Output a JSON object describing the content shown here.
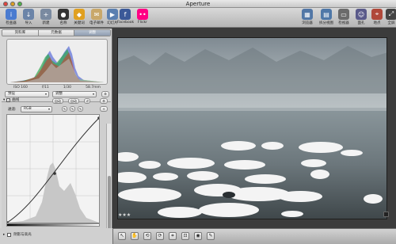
{
  "window": {
    "title": "Aperture"
  },
  "toolbar": {
    "left": [
      {
        "label": "检查器",
        "icon": "info-icon",
        "color": "#4a7bd0"
      },
      {
        "label": "导入",
        "icon": "import-arrow-icon",
        "color": "#6b84a8"
      },
      {
        "label": "新建",
        "icon": "new-folder-icon",
        "color": "#7a8aa0"
      },
      {
        "label": "名称",
        "icon": "person-silhouette-icon",
        "color": "#333333"
      },
      {
        "label": "关键词",
        "icon": "keyword-tag-icon",
        "color": "#e0a020"
      },
      {
        "label": "电子邮件",
        "icon": "envelope-icon",
        "color": "#c9a86a"
      },
      {
        "label": "幻灯片",
        "icon": "slideshow-icon",
        "color": "#5b7fb0"
      },
      {
        "label": "Facebook",
        "icon": "facebook-icon",
        "color": "#3b5998"
      },
      {
        "label": "Flickr",
        "icon": "flickr-icon",
        "color": "#ff0084"
      }
    ],
    "right": [
      {
        "label": "浏览器",
        "icon": "grid-browser-icon",
        "color": "#5277a6"
      },
      {
        "label": "拆分视图",
        "icon": "split-view-icon",
        "color": "#4f78a8"
      },
      {
        "label": "检视器",
        "icon": "viewer-icon",
        "color": "#6b6b6b"
      },
      {
        "label": "面孔",
        "icon": "faces-icon",
        "color": "#5a5a8a"
      },
      {
        "label": "地点",
        "icon": "places-pin-icon",
        "color": "#b0483a"
      },
      {
        "label": "全屏",
        "icon": "fullscreen-icon",
        "color": "#444444"
      }
    ]
  },
  "inspector": {
    "tabs": [
      "资料库",
      "元数据",
      "调整"
    ],
    "active_tab": 2,
    "exif": [
      "ISO 160",
      "f/11",
      "1/30",
      "58.7mm"
    ],
    "preset_select": "预设",
    "adjust_select": "调整",
    "curves": {
      "title": "曲线",
      "auto_label": "自动",
      "channel_label": "通道:",
      "channel_value": "RGB",
      "range_label": "范围:",
      "range_value": "正常",
      "input_label": "入点:",
      "input_value": "0.775",
      "output_label": "出点:",
      "output_value": "0.957"
    },
    "footer_section": "阴影与高光"
  },
  "viewer": {
    "rating": "★★★"
  },
  "colors": {
    "histogram_red": "#d33a2c",
    "histogram_green": "#2fa84f",
    "histogram_blue": "#3a64d8"
  }
}
